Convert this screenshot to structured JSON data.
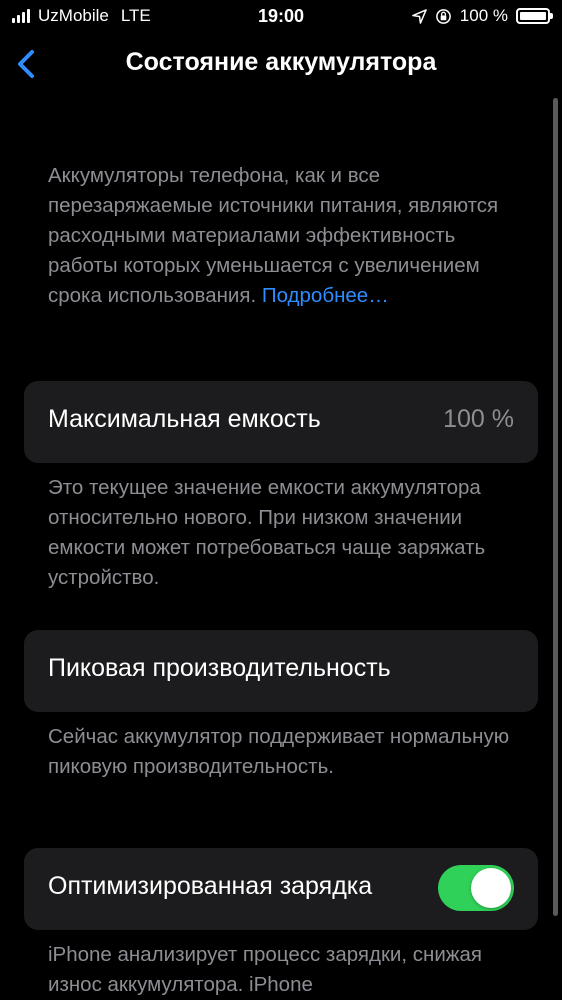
{
  "status_bar": {
    "carrier": "UzMobile",
    "network": "LTE",
    "time": "19:00",
    "battery_percent": "100 %",
    "battery_level": 1.0
  },
  "nav": {
    "back_icon": "chevron-left-icon",
    "title": "Состояние аккумулятора"
  },
  "intro": {
    "text": "Аккумуляторы телефона, как и все перезаряжаемые источники питания, являются расходными материалами эффективность работы которых уменьшается с увеличением срока использования.",
    "link": "Подробнее…"
  },
  "max_capacity": {
    "label": "Максимальная емкость",
    "value": "100 %",
    "footer": "Это текущее значение емкости аккумулятора относительно нового. При низком значении емкости может потребоваться чаще заряжать устройство."
  },
  "peak_performance": {
    "label": "Пиковая производительность",
    "footer": "Сейчас аккумулятор поддерживает нормальную пиковую производительность."
  },
  "optimized_charging": {
    "label": "Оптимизированная зарядка",
    "enabled": true,
    "accent": "#30d158",
    "footer": "iPhone анализирует процесс зарядки, снижая износ аккумулятора. iPhone"
  },
  "colors": {
    "background": "#000000",
    "cell": "#1c1c1e",
    "secondary_text": "#8d8d93",
    "link": "#2f8cff"
  }
}
